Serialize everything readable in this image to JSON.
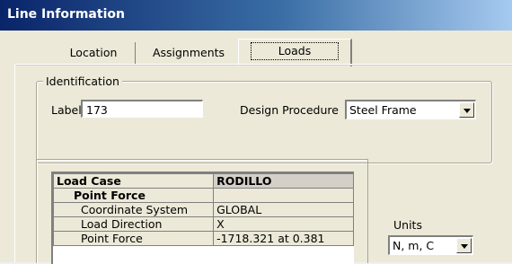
{
  "window": {
    "title": "Line Information"
  },
  "tabs": [
    {
      "label": "Location"
    },
    {
      "label": "Assignments"
    },
    {
      "label": "Loads",
      "active": true
    }
  ],
  "identification": {
    "legend": "Identification",
    "label_caption": "Label",
    "label_value": "173",
    "design_caption": "Design Procedure",
    "design_value": "Steel Frame"
  },
  "grid": {
    "header": {
      "col1": "Load Case",
      "col2": "RODILLO"
    },
    "category": "Point Force",
    "rows": [
      {
        "name": "Coordinate System",
        "value": "GLOBAL"
      },
      {
        "name": "Load Direction",
        "value": "X"
      },
      {
        "name": "Point Force",
        "value": "-1718.321 at 0.381"
      }
    ]
  },
  "units": {
    "caption": "Units",
    "value": "N, m, C"
  },
  "colors": {
    "title_start": "#0a246a",
    "title_end": "#a6caf0",
    "face": "#ece9d8"
  }
}
